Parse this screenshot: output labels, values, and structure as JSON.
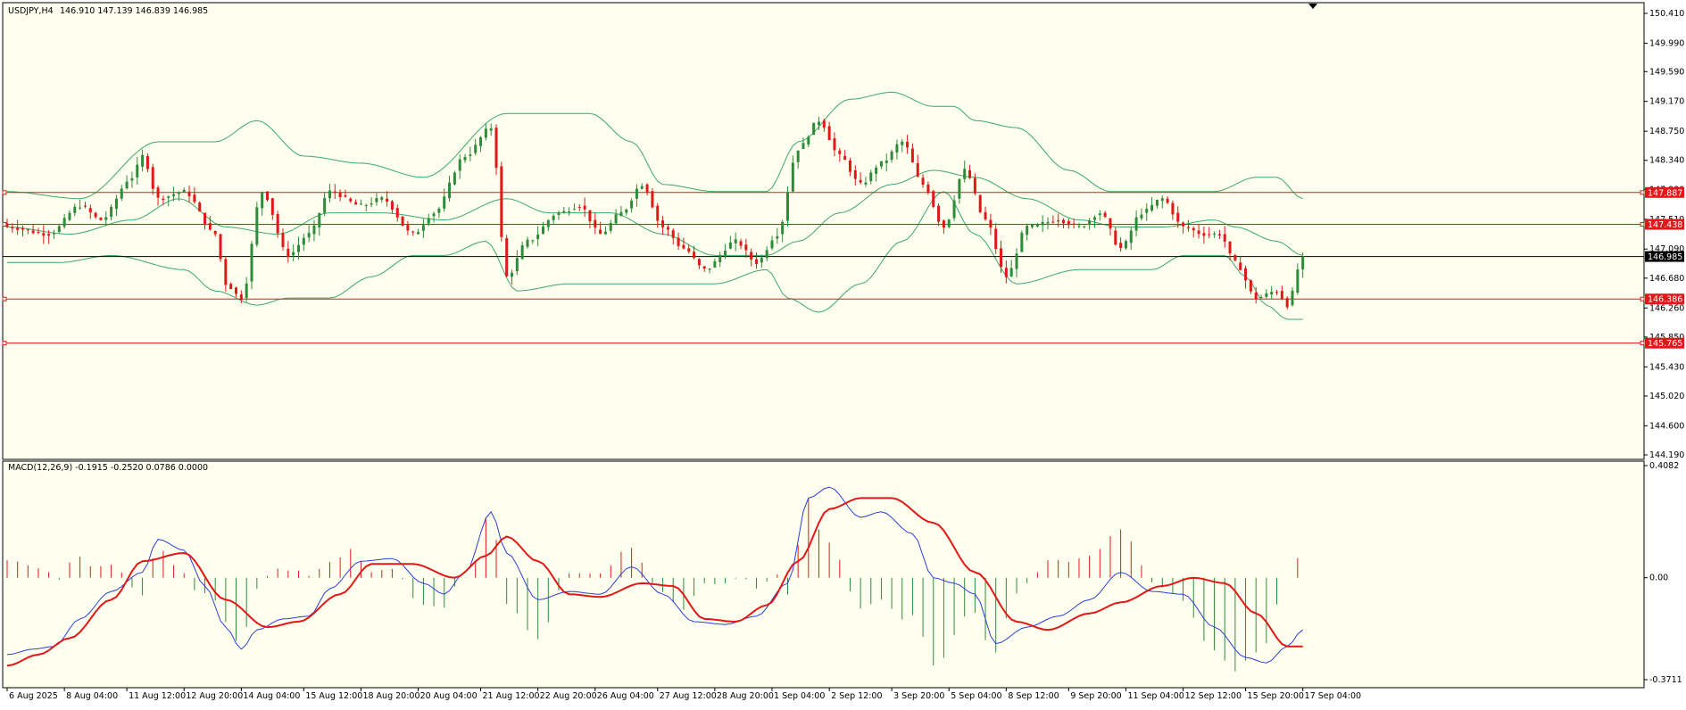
{
  "header": {
    "symbol_label": "USDJPY,H4",
    "ohlc_label": "146.910 147.139 146.839 146.985",
    "indicator_label": "MACD(12,26,9) -0.1915 -0.2520 0.0786 0.0000"
  },
  "colors": {
    "background": "#fffff0",
    "bull_candle": "#2e8b3a",
    "bear_candle": "#e01818",
    "bollinger": "#3aa86a",
    "level_line": "#e01818",
    "current_line": "#000000",
    "macd_line": "#2a3fd6",
    "signal_line": "#e01818",
    "hist_positive": "#e01818",
    "hist_negative": "#2e8b3a"
  },
  "chart_data": [
    {
      "type": "candlestick",
      "name": "USDJPY,H4",
      "price_axis_labels": [
        "150.410",
        "149.990",
        "149.590",
        "149.170",
        "148.750",
        "148.340",
        "147.930",
        "147.510",
        "147.090",
        "146.680",
        "146.260",
        "145.850",
        "145.430",
        "145.020",
        "144.600",
        "144.190"
      ],
      "ylim": [
        144.19,
        150.41
      ],
      "x_axis_labels": [
        "6 Aug 2025",
        "8 Aug 04:00",
        "11 Aug 12:00",
        "12 Aug 20:00",
        "14 Aug 04:00",
        "15 Aug 12:00",
        "18 Aug 20:00",
        "20 Aug 04:00",
        "21 Aug 12:00",
        "22 Aug 20:00",
        "26 Aug 04:00",
        "27 Aug 12:00",
        "28 Aug 20:00",
        "1 Sep 04:00",
        "2 Sep 12:00",
        "3 Sep 20:00",
        "5 Sep 04:00",
        "8 Sep 12:00",
        "9 Sep 20:00",
        "11 Sep 04:00",
        "12 Sep 12:00",
        "15 Sep 20:00",
        "17 Sep 04:00"
      ],
      "horizontal_levels": [
        {
          "value": 147.887,
          "label": "147.887"
        },
        {
          "value": 147.438,
          "label": "147.438"
        },
        {
          "value": 146.386,
          "label": "146.386"
        },
        {
          "value": 145.765,
          "label": "145.765"
        }
      ],
      "current_price": {
        "value": 146.985,
        "label": "146.985"
      },
      "candle_anchors": [
        {
          "i": 0,
          "v": 147.4
        },
        {
          "i": 8,
          "v": 147.3
        },
        {
          "i": 14,
          "v": 147.7
        },
        {
          "i": 18,
          "v": 147.5
        },
        {
          "i": 24,
          "v": 148.1
        },
        {
          "i": 26,
          "v": 148.4
        },
        {
          "i": 29,
          "v": 147.8
        },
        {
          "i": 34,
          "v": 147.9
        },
        {
          "i": 40,
          "v": 147.3
        },
        {
          "i": 42,
          "v": 146.6
        },
        {
          "i": 45,
          "v": 146.4
        },
        {
          "i": 49,
          "v": 147.9
        },
        {
          "i": 54,
          "v": 147.0
        },
        {
          "i": 58,
          "v": 147.3
        },
        {
          "i": 62,
          "v": 147.9
        },
        {
          "i": 68,
          "v": 147.7
        },
        {
          "i": 72,
          "v": 147.8
        },
        {
          "i": 78,
          "v": 147.3
        },
        {
          "i": 82,
          "v": 147.6
        },
        {
          "i": 88,
          "v": 148.4
        },
        {
          "i": 93,
          "v": 148.8
        },
        {
          "i": 96,
          "v": 146.7
        },
        {
          "i": 100,
          "v": 147.2
        },
        {
          "i": 106,
          "v": 147.6
        },
        {
          "i": 110,
          "v": 147.7
        },
        {
          "i": 114,
          "v": 147.3
        },
        {
          "i": 118,
          "v": 147.6
        },
        {
          "i": 122,
          "v": 148.0
        },
        {
          "i": 126,
          "v": 147.4
        },
        {
          "i": 130,
          "v": 147.1
        },
        {
          "i": 134,
          "v": 146.8
        },
        {
          "i": 140,
          "v": 147.2
        },
        {
          "i": 144,
          "v": 146.9
        },
        {
          "i": 148,
          "v": 147.3
        },
        {
          "i": 152,
          "v": 148.5
        },
        {
          "i": 156,
          "v": 148.9
        },
        {
          "i": 160,
          "v": 148.4
        },
        {
          "i": 164,
          "v": 148.0
        },
        {
          "i": 168,
          "v": 148.3
        },
        {
          "i": 172,
          "v": 148.6
        },
        {
          "i": 176,
          "v": 148.0
        },
        {
          "i": 180,
          "v": 147.4
        },
        {
          "i": 184,
          "v": 148.2
        },
        {
          "i": 188,
          "v": 147.5
        },
        {
          "i": 192,
          "v": 146.7
        },
        {
          "i": 196,
          "v": 147.4
        },
        {
          "i": 202,
          "v": 147.5
        },
        {
          "i": 206,
          "v": 147.4
        },
        {
          "i": 210,
          "v": 147.6
        },
        {
          "i": 214,
          "v": 147.1
        },
        {
          "i": 218,
          "v": 147.6
        },
        {
          "i": 222,
          "v": 147.8
        },
        {
          "i": 226,
          "v": 147.4
        },
        {
          "i": 230,
          "v": 147.3
        },
        {
          "i": 233,
          "v": 147.3
        },
        {
          "i": 236,
          "v": 146.9
        },
        {
          "i": 240,
          "v": 146.4
        },
        {
          "i": 244,
          "v": 146.5
        },
        {
          "i": 246,
          "v": 146.3
        },
        {
          "i": 249,
          "v": 146.98
        }
      ],
      "bollinger_upper_anchors": [
        {
          "i": 0,
          "v": 147.9
        },
        {
          "i": 14,
          "v": 147.8
        },
        {
          "i": 29,
          "v": 148.6
        },
        {
          "i": 40,
          "v": 148.6
        },
        {
          "i": 48,
          "v": 148.9
        },
        {
          "i": 57,
          "v": 148.4
        },
        {
          "i": 68,
          "v": 148.3
        },
        {
          "i": 80,
          "v": 148.1
        },
        {
          "i": 96,
          "v": 149.0
        },
        {
          "i": 112,
          "v": 149.0
        },
        {
          "i": 120,
          "v": 148.6
        },
        {
          "i": 126,
          "v": 148.0
        },
        {
          "i": 136,
          "v": 147.9
        },
        {
          "i": 146,
          "v": 147.9
        },
        {
          "i": 152,
          "v": 148.6
        },
        {
          "i": 162,
          "v": 149.2
        },
        {
          "i": 170,
          "v": 149.3
        },
        {
          "i": 178,
          "v": 149.1
        },
        {
          "i": 182,
          "v": 149.1
        },
        {
          "i": 186,
          "v": 148.9
        },
        {
          "i": 194,
          "v": 148.8
        },
        {
          "i": 204,
          "v": 148.2
        },
        {
          "i": 212,
          "v": 147.9
        },
        {
          "i": 222,
          "v": 147.9
        },
        {
          "i": 232,
          "v": 147.9
        },
        {
          "i": 240,
          "v": 148.1
        },
        {
          "i": 244,
          "v": 148.1
        },
        {
          "i": 249,
          "v": 147.8
        }
      ],
      "bollinger_middle_anchors": [
        {
          "i": 0,
          "v": 147.4
        },
        {
          "i": 12,
          "v": 147.3
        },
        {
          "i": 24,
          "v": 147.5
        },
        {
          "i": 33,
          "v": 147.8
        },
        {
          "i": 42,
          "v": 147.4
        },
        {
          "i": 52,
          "v": 147.3
        },
        {
          "i": 62,
          "v": 147.6
        },
        {
          "i": 72,
          "v": 147.6
        },
        {
          "i": 84,
          "v": 147.5
        },
        {
          "i": 96,
          "v": 147.8
        },
        {
          "i": 104,
          "v": 147.6
        },
        {
          "i": 116,
          "v": 147.6
        },
        {
          "i": 126,
          "v": 147.3
        },
        {
          "i": 136,
          "v": 147.0
        },
        {
          "i": 146,
          "v": 147.0
        },
        {
          "i": 152,
          "v": 147.2
        },
        {
          "i": 160,
          "v": 147.6
        },
        {
          "i": 170,
          "v": 148.0
        },
        {
          "i": 178,
          "v": 148.2
        },
        {
          "i": 186,
          "v": 148.1
        },
        {
          "i": 196,
          "v": 147.8
        },
        {
          "i": 206,
          "v": 147.5
        },
        {
          "i": 214,
          "v": 147.4
        },
        {
          "i": 222,
          "v": 147.4
        },
        {
          "i": 232,
          "v": 147.5
        },
        {
          "i": 236,
          "v": 147.4
        },
        {
          "i": 244,
          "v": 147.2
        },
        {
          "i": 249,
          "v": 147.0
        }
      ],
      "bollinger_lower_anchors": [
        {
          "i": 0,
          "v": 146.9
        },
        {
          "i": 10,
          "v": 146.9
        },
        {
          "i": 20,
          "v": 147.0
        },
        {
          "i": 34,
          "v": 146.8
        },
        {
          "i": 40,
          "v": 146.5
        },
        {
          "i": 48,
          "v": 146.3
        },
        {
          "i": 54,
          "v": 146.4
        },
        {
          "i": 62,
          "v": 146.4
        },
        {
          "i": 70,
          "v": 146.7
        },
        {
          "i": 78,
          "v": 147.0
        },
        {
          "i": 84,
          "v": 147.0
        },
        {
          "i": 92,
          "v": 147.2
        },
        {
          "i": 98,
          "v": 146.5
        },
        {
          "i": 108,
          "v": 146.6
        },
        {
          "i": 116,
          "v": 146.6
        },
        {
          "i": 126,
          "v": 146.6
        },
        {
          "i": 136,
          "v": 146.6
        },
        {
          "i": 146,
          "v": 146.8
        },
        {
          "i": 150,
          "v": 146.4
        },
        {
          "i": 156,
          "v": 146.2
        },
        {
          "i": 164,
          "v": 146.6
        },
        {
          "i": 172,
          "v": 147.2
        },
        {
          "i": 180,
          "v": 147.9
        },
        {
          "i": 186,
          "v": 147.3
        },
        {
          "i": 194,
          "v": 146.6
        },
        {
          "i": 206,
          "v": 146.8
        },
        {
          "i": 214,
          "v": 146.8
        },
        {
          "i": 220,
          "v": 146.8
        },
        {
          "i": 226,
          "v": 147.0
        },
        {
          "i": 234,
          "v": 147.0
        },
        {
          "i": 238,
          "v": 146.7
        },
        {
          "i": 242,
          "v": 146.3
        },
        {
          "i": 246,
          "v": 146.1
        },
        {
          "i": 249,
          "v": 146.1
        }
      ]
    },
    {
      "type": "line",
      "name": "MACD(12,26,9)",
      "macd_axis_labels": [
        "0.4082",
        "0.00",
        "-0.3711"
      ],
      "ylim": [
        -0.3711,
        0.4082
      ],
      "macd_line_anchors": [
        {
          "i": 0,
          "v": -0.28
        },
        {
          "i": 5,
          "v": -0.26
        },
        {
          "i": 9,
          "v": -0.25
        },
        {
          "i": 14,
          "v": -0.15
        },
        {
          "i": 20,
          "v": -0.05
        },
        {
          "i": 26,
          "v": 0.02
        },
        {
          "i": 29,
          "v": 0.14
        },
        {
          "i": 34,
          "v": 0.1
        },
        {
          "i": 38,
          "v": -0.03
        },
        {
          "i": 42,
          "v": -0.18
        },
        {
          "i": 45,
          "v": -0.26
        },
        {
          "i": 48,
          "v": -0.19
        },
        {
          "i": 53,
          "v": -0.15
        },
        {
          "i": 58,
          "v": -0.14
        },
        {
          "i": 62,
          "v": -0.04
        },
        {
          "i": 68,
          "v": 0.06
        },
        {
          "i": 74,
          "v": 0.07
        },
        {
          "i": 80,
          "v": -0.02
        },
        {
          "i": 84,
          "v": -0.06
        },
        {
          "i": 88,
          "v": 0.02
        },
        {
          "i": 93,
          "v": 0.24
        },
        {
          "i": 96,
          "v": 0.09
        },
        {
          "i": 102,
          "v": -0.08
        },
        {
          "i": 108,
          "v": -0.05
        },
        {
          "i": 114,
          "v": -0.06
        },
        {
          "i": 120,
          "v": 0.04
        },
        {
          "i": 126,
          "v": -0.06
        },
        {
          "i": 132,
          "v": -0.16
        },
        {
          "i": 138,
          "v": -0.17
        },
        {
          "i": 144,
          "v": -0.14
        },
        {
          "i": 150,
          "v": -0.02
        },
        {
          "i": 154,
          "v": 0.29
        },
        {
          "i": 158,
          "v": 0.33
        },
        {
          "i": 164,
          "v": 0.22
        },
        {
          "i": 168,
          "v": 0.24
        },
        {
          "i": 174,
          "v": 0.16
        },
        {
          "i": 178,
          "v": 0.0
        },
        {
          "i": 182,
          "v": -0.02
        },
        {
          "i": 186,
          "v": -0.06
        },
        {
          "i": 190,
          "v": -0.24
        },
        {
          "i": 196,
          "v": -0.18
        },
        {
          "i": 202,
          "v": -0.14
        },
        {
          "i": 208,
          "v": -0.08
        },
        {
          "i": 214,
          "v": 0.02
        },
        {
          "i": 220,
          "v": -0.05
        },
        {
          "i": 226,
          "v": -0.06
        },
        {
          "i": 232,
          "v": -0.18
        },
        {
          "i": 238,
          "v": -0.29
        },
        {
          "i": 242,
          "v": -0.31
        },
        {
          "i": 246,
          "v": -0.25
        },
        {
          "i": 249,
          "v": -0.19
        }
      ],
      "signal_line_anchors": [
        {
          "i": 0,
          "v": -0.32
        },
        {
          "i": 6,
          "v": -0.28
        },
        {
          "i": 12,
          "v": -0.22
        },
        {
          "i": 20,
          "v": -0.08
        },
        {
          "i": 26,
          "v": 0.06
        },
        {
          "i": 34,
          "v": 0.09
        },
        {
          "i": 42,
          "v": -0.08
        },
        {
          "i": 50,
          "v": -0.18
        },
        {
          "i": 56,
          "v": -0.16
        },
        {
          "i": 64,
          "v": -0.06
        },
        {
          "i": 70,
          "v": 0.05
        },
        {
          "i": 78,
          "v": 0.05
        },
        {
          "i": 86,
          "v": 0.0
        },
        {
          "i": 92,
          "v": 0.08
        },
        {
          "i": 96,
          "v": 0.15
        },
        {
          "i": 102,
          "v": 0.06
        },
        {
          "i": 108,
          "v": -0.06
        },
        {
          "i": 114,
          "v": -0.07
        },
        {
          "i": 122,
          "v": -0.02
        },
        {
          "i": 128,
          "v": -0.03
        },
        {
          "i": 134,
          "v": -0.15
        },
        {
          "i": 140,
          "v": -0.16
        },
        {
          "i": 146,
          "v": -0.1
        },
        {
          "i": 152,
          "v": 0.06
        },
        {
          "i": 158,
          "v": 0.25
        },
        {
          "i": 164,
          "v": 0.29
        },
        {
          "i": 170,
          "v": 0.29
        },
        {
          "i": 178,
          "v": 0.2
        },
        {
          "i": 186,
          "v": 0.02
        },
        {
          "i": 194,
          "v": -0.16
        },
        {
          "i": 200,
          "v": -0.19
        },
        {
          "i": 208,
          "v": -0.13
        },
        {
          "i": 214,
          "v": -0.09
        },
        {
          "i": 222,
          "v": -0.03
        },
        {
          "i": 228,
          "v": 0.0
        },
        {
          "i": 234,
          "v": -0.02
        },
        {
          "i": 240,
          "v": -0.13
        },
        {
          "i": 246,
          "v": -0.25
        },
        {
          "i": 249,
          "v": -0.25
        }
      ]
    }
  ]
}
